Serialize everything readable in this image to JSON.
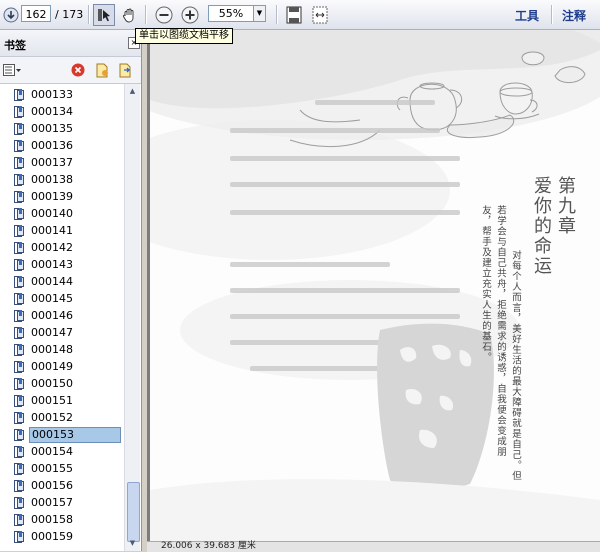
{
  "toolbar": {
    "current_page": "162",
    "page_total": "/ 173",
    "zoom": "55%",
    "tools_label": "工具",
    "comment_label": "注释"
  },
  "tooltip": "单击以图缆文档平移",
  "panel": {
    "title": "书签",
    "bookmarks": [
      "000133",
      "000134",
      "000135",
      "000136",
      "000137",
      "000138",
      "000139",
      "000140",
      "000141",
      "000142",
      "000143",
      "000144",
      "000145",
      "000146",
      "000147",
      "000148",
      "000149",
      "000150",
      "000151",
      "000152",
      "000153",
      "000154",
      "000155",
      "000156",
      "000157",
      "000158",
      "000159"
    ],
    "selected": "000153"
  },
  "document": {
    "chapter_title_1": "第九章",
    "chapter_title_2": "爱你的命运",
    "epigraph_lines": [
      "对每个人而言，美好生活的最大障碍就是自己。但",
      "若学会与自己共舟，拒绝需求的诱惑，自我便会变成朋",
      "友，帮手及建立充实人生的基石。"
    ]
  },
  "status": "26.006 x 39.683 厘米",
  "colors": {
    "accent": "#1f3d8c",
    "selection": "#a8c8e8"
  }
}
